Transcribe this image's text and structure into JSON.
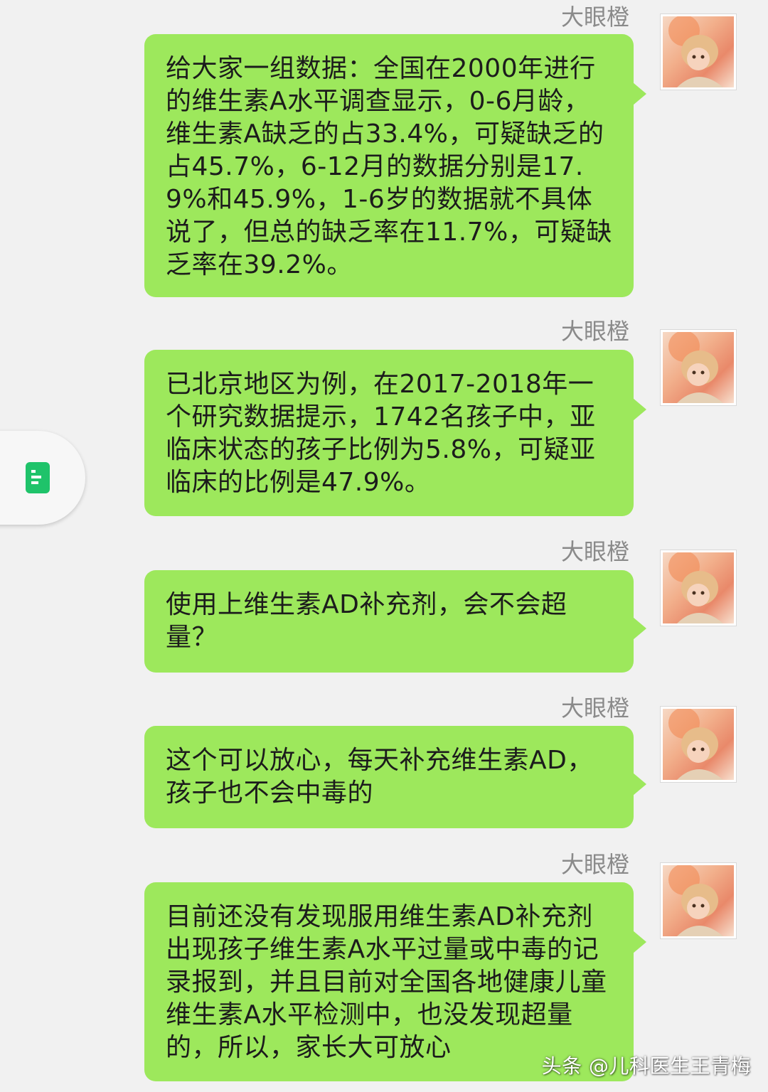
{
  "messages": [
    {
      "sender": "大眼橙",
      "text": "给大家一组数据：全国在2000年进行的维生素A水平调查显示，0-6月龄，维生素A缺乏的占33.4%，可疑缺乏的占45.7%，6-12月的数据分别是17.9%和45.9%，1-6岁的数据就不具体说了，但总的缺乏率在11.7%，可疑缺乏率在39.2%。"
    },
    {
      "sender": "大眼橙",
      "text": "已北京地区为例，在2017-2018年一个研究数据提示，1742名孩子中，亚临床状态的孩子比例为5.8%，可疑亚临床的比例是47.9%。"
    },
    {
      "sender": "大眼橙",
      "text": "使用上维生素AD补充剂，会不会超量？"
    },
    {
      "sender": "大眼橙",
      "text": "这个可以放心，每天补充维生素AD，孩子也不会中毒的"
    },
    {
      "sender": "大眼橙",
      "text": "目前还没有发现服用维生素AD补充剂出现孩子维生素A水平过量或中毒的记录报到，并且目前对全国各地健康儿童维生素A水平检测中，也没发现超量的，所以，家长大可放心"
    }
  ],
  "floating_button": {
    "icon": "document-icon",
    "color": "#1fc36a"
  },
  "watermark": "头条 @儿科医生王青梅",
  "colors": {
    "bubble": "#9de85c",
    "background": "#f1f1f1",
    "sender_name": "#8a8a8a"
  }
}
